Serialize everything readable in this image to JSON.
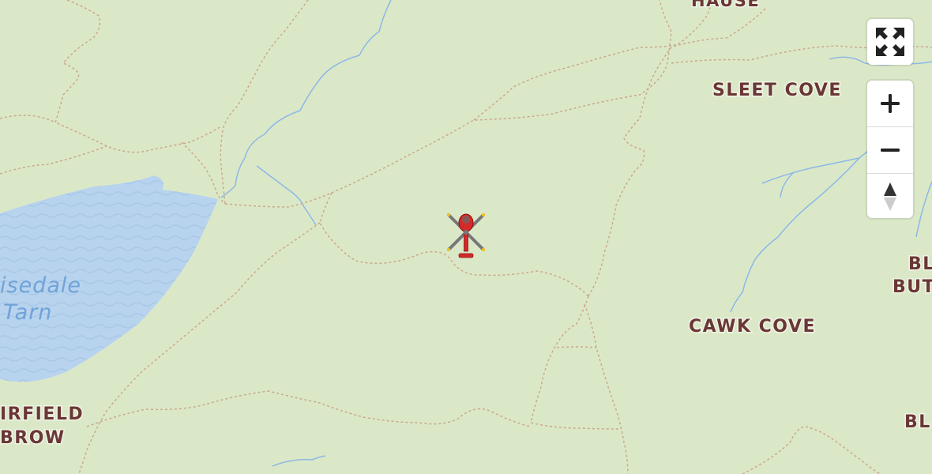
{
  "map": {
    "labels": {
      "hause": "HAUSE",
      "sleet_cove": "SLEET COVE",
      "cawk_cove": "CAWK COVE",
      "bl_butt_1": "BL",
      "bl_butt_2": "BUT",
      "bl_lower": "BL",
      "airfield_1": "IRFIELD",
      "airfield_2": "BROW",
      "tarn_1": "isedale",
      "tarn_2": "Tarn"
    },
    "colors": {
      "land": "#dbe8c8",
      "water": "#b7d3ee",
      "stream": "#8cb8e6",
      "path": "#c9a98a",
      "label": "#6b3636",
      "marker": "#d42a2a"
    },
    "marker_icon": "helicopter-icon"
  },
  "controls": {
    "fullscreen_icon": "fullscreen-icon",
    "zoom_in_icon": "zoom-in-icon",
    "zoom_out_icon": "zoom-out-icon",
    "compass_icon": "compass-icon"
  }
}
